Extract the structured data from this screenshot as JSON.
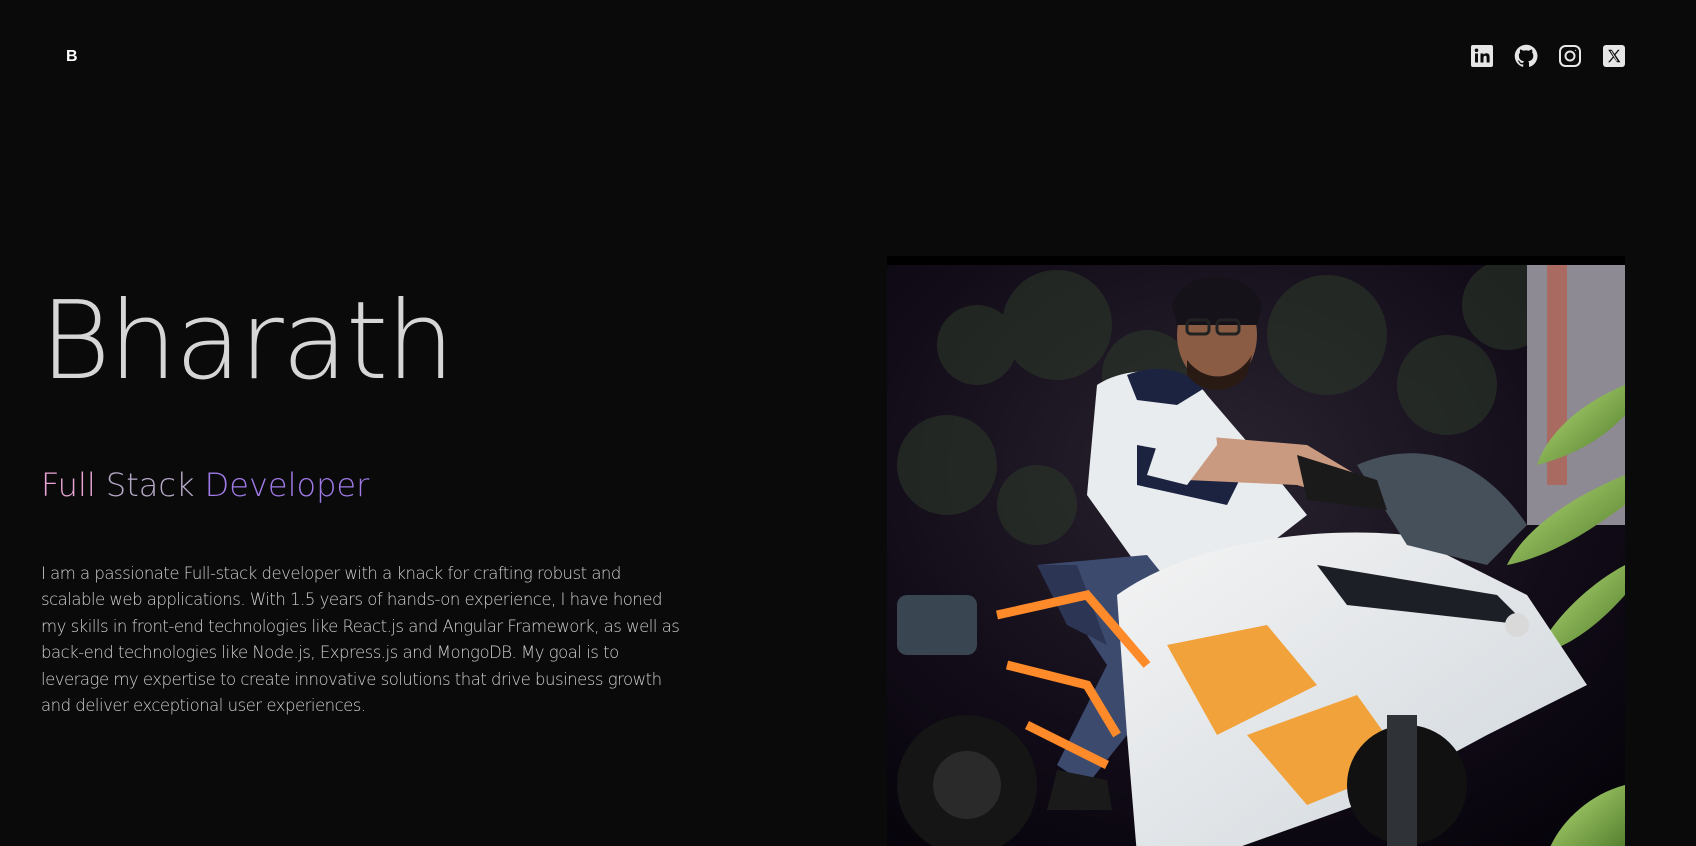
{
  "header": {
    "logo": "B",
    "socials": [
      {
        "icon": "linkedin-icon"
      },
      {
        "icon": "github-icon"
      },
      {
        "icon": "instagram-icon"
      },
      {
        "icon": "x-icon"
      }
    ]
  },
  "hero": {
    "name": "Bharath",
    "role_words": [
      "Full",
      "Stack",
      "Developer"
    ],
    "bio": "I am a passionate Full-stack developer with a knack for crafting robust and scalable web applications. With 1.5 years of hands-on experience, I have honed my skills in front-end technologies like React.js and Angular Framework, as well as back-end technologies like Node.js, Express.js and MongoDB. My goal is to leverage my expertise to create innovative solutions that drive business growth and deliver exceptional user experiences."
  },
  "colors": {
    "background": "#0a0a0a",
    "role_full": "#e8a4d4",
    "role_stack": "#b7a9c8",
    "role_developer": "#a07be8"
  }
}
